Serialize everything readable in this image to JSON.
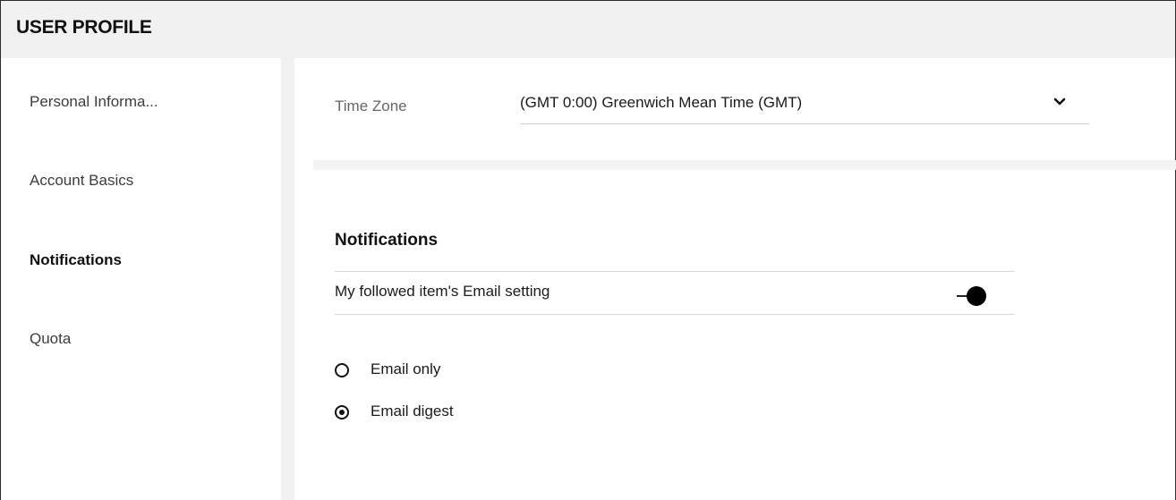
{
  "header": {
    "title": "USER PROFILE"
  },
  "sidebar": {
    "items": [
      {
        "label": "Personal Informa..."
      },
      {
        "label": "Account Basics"
      },
      {
        "label": "Notifications",
        "active": true
      },
      {
        "label": "Quota"
      }
    ]
  },
  "timezone": {
    "label": "Time Zone",
    "value": "(GMT 0:00) Greenwich Mean Time (GMT)",
    "icon": "chevron-down-icon"
  },
  "notifications": {
    "heading": "Notifications",
    "followed_setting_label": "My followed item's Email setting",
    "followed_setting_enabled": true,
    "options": [
      {
        "label": "Email only",
        "selected": false
      },
      {
        "label": "Email digest",
        "selected": true
      }
    ]
  },
  "colors": {
    "header_bg": "#f1f1f1",
    "text": "#1a1a1a",
    "accent": "#000000"
  }
}
